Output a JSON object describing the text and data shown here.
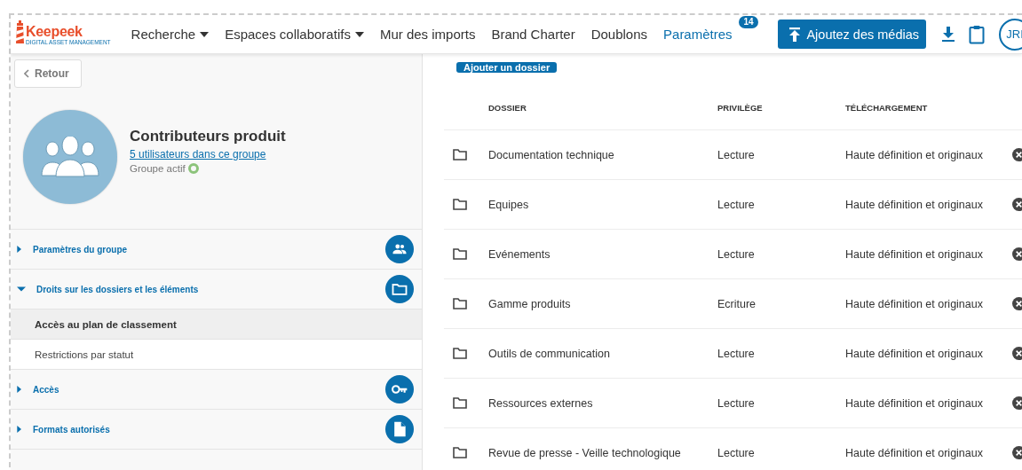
{
  "header": {
    "logo": {
      "name": "Keepeek",
      "tagline": "DIGITAL ASSET MANAGEMENT"
    },
    "nav": [
      {
        "label": "Recherche",
        "dropdown": true,
        "selected": false
      },
      {
        "label": "Espaces collaboratifs",
        "dropdown": true,
        "selected": false
      },
      {
        "label": "Mur des imports",
        "dropdown": false,
        "selected": false
      },
      {
        "label": "Brand Charter",
        "dropdown": false,
        "selected": false
      },
      {
        "label": "Doublons",
        "dropdown": false,
        "selected": false
      },
      {
        "label": "Paramètres",
        "dropdown": false,
        "selected": true,
        "badge": "14"
      }
    ],
    "upload_button": "Ajoutez des médias",
    "user_initials": "JRI"
  },
  "sidebar": {
    "back_button": "Retour",
    "group": {
      "name": "Contributeurs produit",
      "members_link": "5 utilisateurs dans ce groupe",
      "status": "Groupe actif",
      "active": true
    },
    "sections": [
      {
        "title": "Paramètres du groupe",
        "expanded": false
      },
      {
        "title": "Droits sur les dossiers et les éléments",
        "expanded": true,
        "children": [
          {
            "label": "Accès au plan de classement",
            "selected": true
          },
          {
            "label": "Restrictions par statut",
            "selected": false
          }
        ]
      },
      {
        "title": "Accès",
        "expanded": false
      },
      {
        "title": "Formats autorisés",
        "expanded": false
      }
    ]
  },
  "content": {
    "add_folder_button": "Ajouter un dossier",
    "table": {
      "columns": [
        "DOSSIER",
        "PRIVILÈGE",
        "TÉLÉCHARGEMENT"
      ],
      "rows": [
        {
          "folder": "Documentation technique",
          "privilege": "Lecture",
          "download": "Haute définition et originaux"
        },
        {
          "folder": "Equipes",
          "privilege": "Lecture",
          "download": "Haute définition et originaux"
        },
        {
          "folder": "Evénements",
          "privilege": "Lecture",
          "download": "Haute définition et originaux"
        },
        {
          "folder": "Gamme produits",
          "privilege": "Ecriture",
          "download": "Haute définition et originaux"
        },
        {
          "folder": "Outils de communication",
          "privilege": "Lecture",
          "download": "Haute définition et originaux"
        },
        {
          "folder": "Ressources externes",
          "privilege": "Lecture",
          "download": "Haute définition et originaux"
        },
        {
          "folder": "Revue de presse - Veille technologique",
          "privilege": "Lecture",
          "download": "Haute définition et originaux"
        }
      ]
    }
  }
}
